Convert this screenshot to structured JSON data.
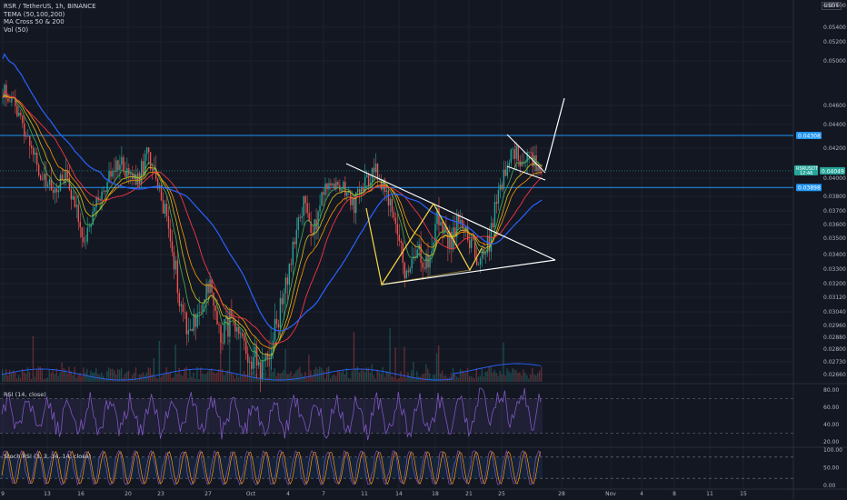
{
  "legend": {
    "symbol": "RSR / TetherUS, 1h, BINANCE",
    "tema": "TEMA (50,100,200)",
    "ma_cross": "MA Cross 50 & 200",
    "vol": "Vol (50)"
  },
  "currency_button": {
    "ccy": "USDT"
  },
  "rsi_label": "RSI (14, close)",
  "stoch_label": "Stoch RSI (3, 3, 14, 14, close)",
  "colors": {
    "bg": "#131722",
    "grid": "#1e222d",
    "text": "#b2b5be",
    "up": "#26a69a",
    "down": "#ef5350",
    "blue_ma": "#2962ff",
    "green_ma": "#4caf50",
    "red_ma": "#f23645",
    "orange_ma": "#ff9800",
    "yellow_ma": "#d4c21e",
    "hline": "#2196f3",
    "pattern_white": "#ffffff",
    "pattern_yellow": "#f5d547",
    "rsi": "#7e57c2",
    "stoch_k": "#7e57c2",
    "stoch_d": "#ff9800"
  },
  "chart_data": {
    "type": "candlestick",
    "price_axis": {
      "ticks": [
        "0.05400",
        "0.05200",
        "0.05000",
        "0.04600",
        "0.04400",
        "0.04200",
        "0.04000",
        "0.03800",
        "0.03700",
        "0.03600",
        "0.03500",
        "0.03400",
        "0.03300",
        "0.03200",
        "0.03120",
        "0.03040",
        "0.02960",
        "0.02880",
        "0.02800",
        "0.02730",
        "0.02660"
      ],
      "top_partial": "0.05600"
    },
    "time_axis": {
      "ticks": [
        "9",
        "13",
        "16",
        "20",
        "23",
        "27",
        "Oct",
        "4",
        "7",
        "11",
        "14",
        "18",
        "21",
        "25",
        "28",
        "Nov",
        "4",
        "8",
        "11",
        "15"
      ]
    },
    "horizontal_levels": [
      {
        "price": 0.04308,
        "label": "0.04308"
      },
      {
        "price": 0.03898,
        "label": "0.03898"
      }
    ],
    "last_price": {
      "ticker": "RSRUSDT",
      "price": "0.04049",
      "countdown": "12:46"
    },
    "close_path": [
      0.0475,
      0.0462,
      0.044,
      0.0418,
      0.0395,
      0.0388,
      0.0402,
      0.0375,
      0.0348,
      0.0372,
      0.0392,
      0.0412,
      0.0405,
      0.0395,
      0.0418,
      0.039,
      0.036,
      0.0315,
      0.0292,
      0.0305,
      0.0318,
      0.029,
      0.0298,
      0.0282,
      0.0276,
      0.027,
      0.0285,
      0.0312,
      0.034,
      0.0375,
      0.0355,
      0.039,
      0.0392,
      0.0388,
      0.0375,
      0.0396,
      0.0405,
      0.0385,
      0.0355,
      0.0322,
      0.034,
      0.0335,
      0.0368,
      0.0345,
      0.0362,
      0.0348,
      0.0332,
      0.035,
      0.039,
      0.042,
      0.041,
      0.0412,
      0.0402
    ],
    "rsi": {
      "levels": [
        70,
        30
      ],
      "ticks": [
        "80.00",
        "60.00",
        "40.00",
        "20.00"
      ]
    },
    "stoch_rsi": {
      "levels": [
        80,
        20
      ],
      "ticks": [
        "100.00",
        "50.00",
        "0.00"
      ]
    }
  }
}
